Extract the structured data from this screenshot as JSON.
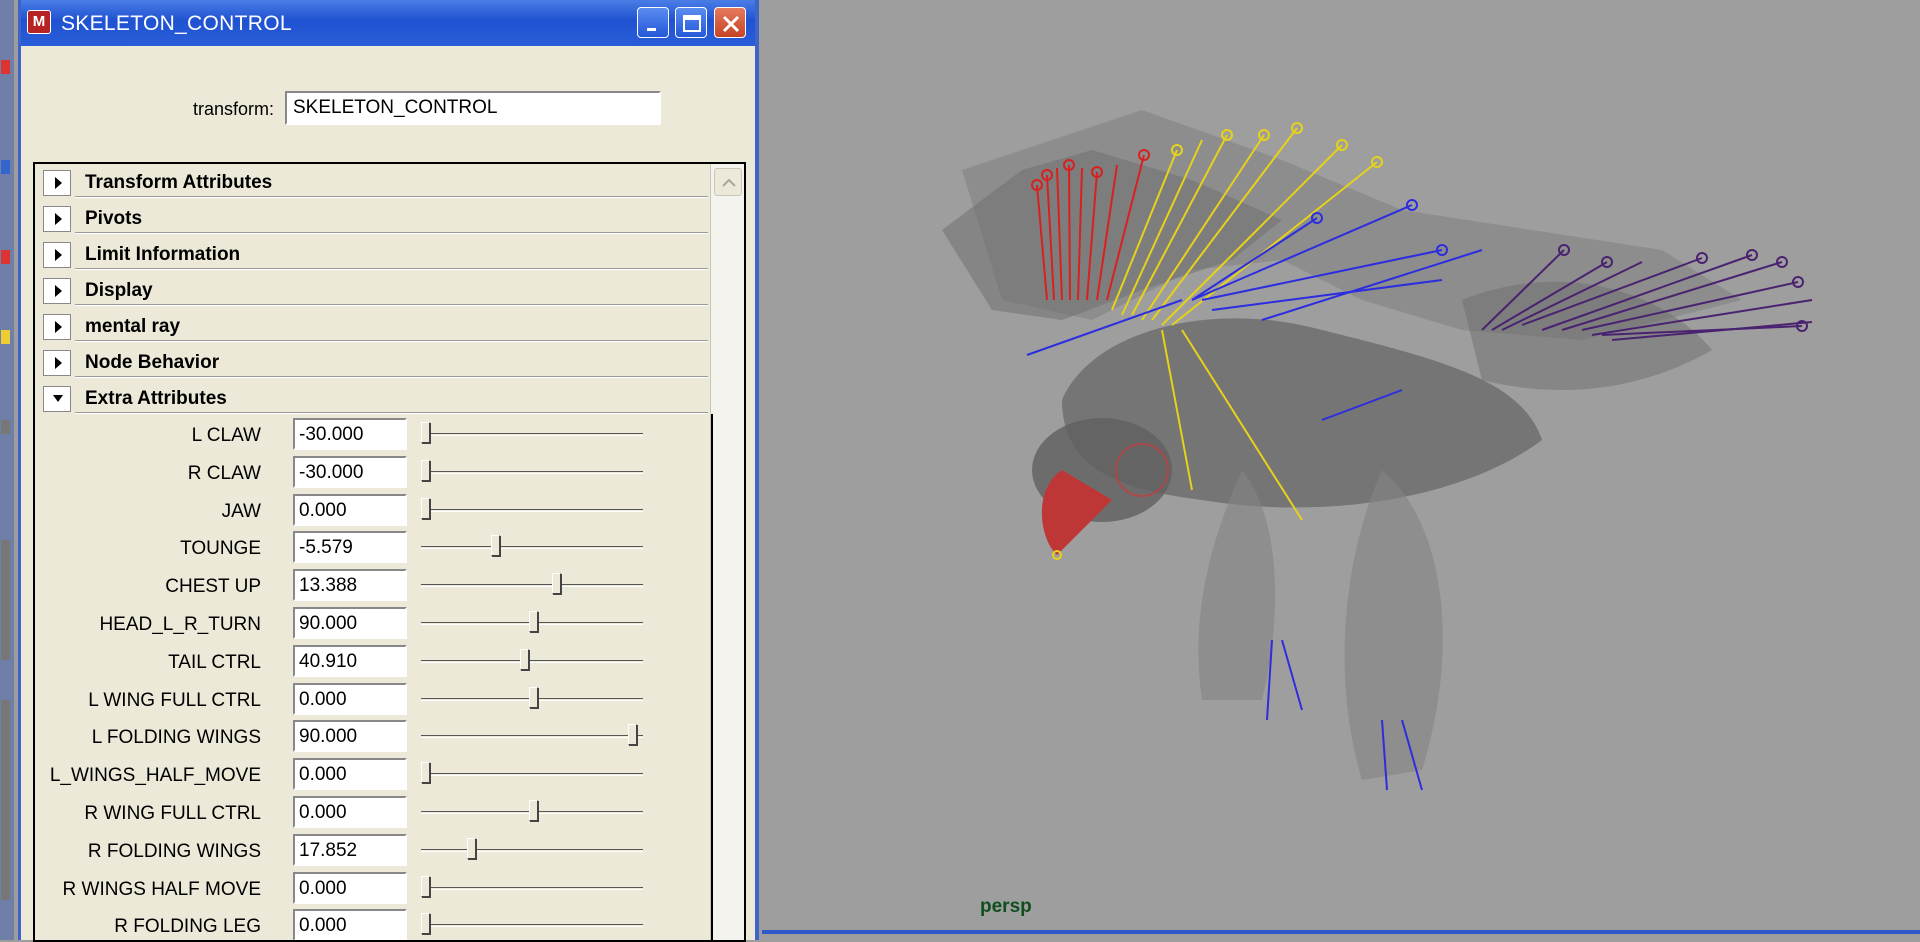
{
  "window": {
    "title": "SKELETON_CONTROL",
    "transform_label": "transform:",
    "transform_value": "SKELETON_CONTROL"
  },
  "sections": [
    {
      "label": "Transform Attributes",
      "expanded": false
    },
    {
      "label": "Pivots",
      "expanded": false
    },
    {
      "label": "Limit Information",
      "expanded": false
    },
    {
      "label": "Display",
      "expanded": false
    },
    {
      "label": "mental ray",
      "expanded": false
    },
    {
      "label": "Node Behavior",
      "expanded": false
    },
    {
      "label": "Extra Attributes",
      "expanded": true
    }
  ],
  "attributes": [
    {
      "label": "L CLAW",
      "value": "-30.000",
      "slider": 0.0
    },
    {
      "label": "R CLAW",
      "value": "-30.000",
      "slider": 0.0
    },
    {
      "label": "JAW",
      "value": "0.000",
      "slider": 0.0
    },
    {
      "label": "TOUNGE",
      "value": "-5.579",
      "slider": 0.33
    },
    {
      "label": "CHEST UP",
      "value": "13.388",
      "slider": 0.62
    },
    {
      "label": "HEAD_L_R_TURN",
      "value": "90.000",
      "slider": 0.51
    },
    {
      "label": "TAIL CTRL",
      "value": "40.910",
      "slider": 0.47
    },
    {
      "label": "L WING FULL CTRL",
      "value": "0.000",
      "slider": 0.51
    },
    {
      "label": "L FOLDING WINGS",
      "value": "90.000",
      "slider": 0.98
    },
    {
      "label": "L_WINGS_HALF_MOVE",
      "value": "0.000",
      "slider": 0.0
    },
    {
      "label": "R WING FULL CTRL",
      "value": "0.000",
      "slider": 0.51
    },
    {
      "label": "R FOLDING WINGS",
      "value": "17.852",
      "slider": 0.22
    },
    {
      "label": "R WINGS HALF MOVE",
      "value": "0.000",
      "slider": 0.0
    },
    {
      "label": "R FOLDING LEG",
      "value": "0.000",
      "slider": 0.0
    }
  ],
  "viewport": {
    "camera_label": "persp"
  },
  "colors": {
    "titlebar": "#2a5ed8",
    "window_bg": "#ece9d8",
    "viewport_bg": "#9e9e9e",
    "camera_label": "#0f4f1f"
  },
  "icons": {
    "app": "maya-icon",
    "minimize": "minimize-icon",
    "maximize": "maximize-icon",
    "close": "close-icon"
  }
}
